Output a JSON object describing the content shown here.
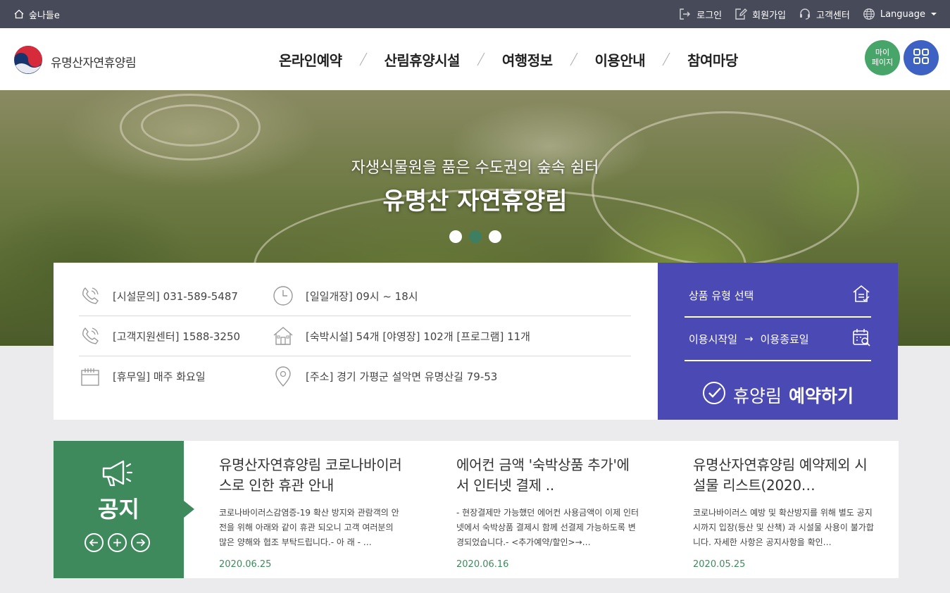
{
  "topbar": {
    "home_label": "숲나들e",
    "login": "로그인",
    "join": "회원가입",
    "support": "고객센터",
    "language": "Language"
  },
  "header": {
    "logo_text": "유명산자연휴양림",
    "menu": [
      "온라인예약",
      "산림휴양시설",
      "여행정보",
      "이용안내",
      "참여마당"
    ],
    "mypage_line1": "마이",
    "mypage_line2": "페이지"
  },
  "hero": {
    "subtitle": "자생식물원을 품은 수도권의 숲속 쉼터",
    "title": "유명산 자연휴양림",
    "slide_count": 3,
    "active_slide": 2
  },
  "info": {
    "facility_phone": "[시설문의] 031-589-5487",
    "hours": "[일일개장] 09시 ~ 18시",
    "support_phone": "[고객지원센터] 1588-3250",
    "facilities": "[숙박시설] 54개 [야영장] 102개 [프로그램] 11개",
    "closed_day": "[휴무일] 매주 화요일",
    "address": "[주소] 경기 가평군 설악면 유명산길 79-53"
  },
  "reserve": {
    "product_type": "상품 유형 선택",
    "start_date": "이용시작일",
    "arrow": "→",
    "end_date": "이용종료일",
    "btn_light": "휴양림",
    "btn_bold": "예약하기"
  },
  "notice": {
    "label": "공지",
    "items": [
      {
        "title": "유명산자연휴양림 코로나바이러스로 인한 휴관 안내",
        "desc": "코로나바이러스감염증-19 확산 방지와 관람객의 안전을 위해 아래와 같이 휴관 되오니 고객 여러분의 많은 양해와 협조 부탁드립니다.- 아 래 - …",
        "date": "2020.06.25"
      },
      {
        "title": "에어컨 금액 '숙박상품 추가'에서 인터넷 결제 ..",
        "desc": "- 현장결제만 가능했던 에어컨 사용금액이 이제 인터넷에서 숙박상품 결제시 함께 선결제 가능하도록  변경되었습니다.-  <추가예약/할인>→…",
        "date": "2020.06.16"
      },
      {
        "title": "유명산자연휴양림 예약제외 시설물 리스트(2020…",
        "desc": "코로나바이러스 예방 및 확산방지를 위해 별도 공지시까지 입장(등산 및 산책) 과 시설물 사용이 불가합니다. 자세한 사항은 공지사항을 확인…",
        "date": "2020.05.25"
      }
    ]
  },
  "colors": {
    "topbar": "#474a59",
    "reserve_panel": "#4b4ab4",
    "notice_green": "#3f8a5d",
    "mypage_green": "#47a56a",
    "allmenu_blue": "#3d62c4",
    "active_dot": "#3f7f61"
  },
  "icons": {
    "home": "home-icon",
    "login": "login-icon",
    "join": "edit-icon",
    "support": "headset-icon",
    "language": "globe-icon",
    "allmenu": "grid-icon",
    "phone": "phone-icon",
    "clock": "clock-icon",
    "house": "house-icon",
    "calendar": "calendar-icon",
    "location": "location-pin-icon",
    "check": "check-circle-icon",
    "megaphone": "megaphone-icon"
  }
}
